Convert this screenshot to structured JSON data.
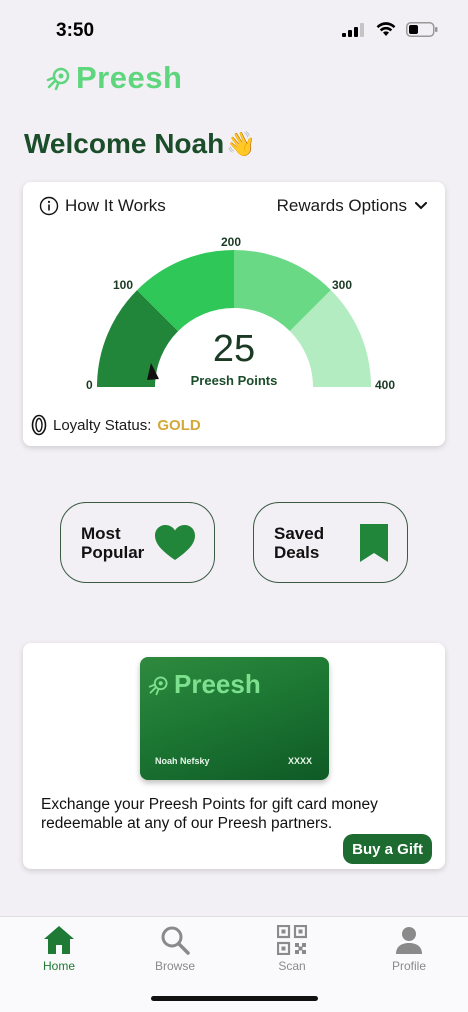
{
  "status_bar": {
    "time": "3:50"
  },
  "brand": {
    "name": "Preesh",
    "accent": "#5ed67d",
    "dark_green": "#1e6b32"
  },
  "welcome": {
    "text": "Welcome Noah",
    "emoji": "👋"
  },
  "points_card": {
    "how_it_works": "How It Works",
    "rewards_options": "Rewards Options",
    "gauge": {
      "value": "25",
      "caption": "Preesh Points",
      "ticks": [
        "0",
        "100",
        "200",
        "300",
        "400"
      ],
      "min": 0,
      "max": 400,
      "current": 25,
      "segment_colors": [
        "#22863a",
        "#2fc758",
        "#6ad986",
        "#b3ecc0"
      ]
    },
    "loyalty_label": "Loyalty Status:",
    "loyalty_level": "GOLD",
    "loyalty_color": "#d4a93a"
  },
  "quick_actions": [
    {
      "label": "Most\nPopular",
      "icon": "heart-icon"
    },
    {
      "label": "Saved\nDeals",
      "icon": "bookmark-icon"
    }
  ],
  "gift_card": {
    "card_brand": "Preesh",
    "card_holder": "Noah Nefsky",
    "card_number": "XXXX",
    "description": "Exchange your Preesh Points for gift card money redeemable at any of our Preesh partners.",
    "button_label": "Buy a Gift"
  },
  "bottom_nav": [
    {
      "label": "Home",
      "icon": "home-icon",
      "active": true
    },
    {
      "label": "Browse",
      "icon": "search-icon",
      "active": false
    },
    {
      "label": "Scan",
      "icon": "qr-code-icon",
      "active": false
    },
    {
      "label": "Profile",
      "icon": "profile-icon",
      "active": false
    }
  ]
}
